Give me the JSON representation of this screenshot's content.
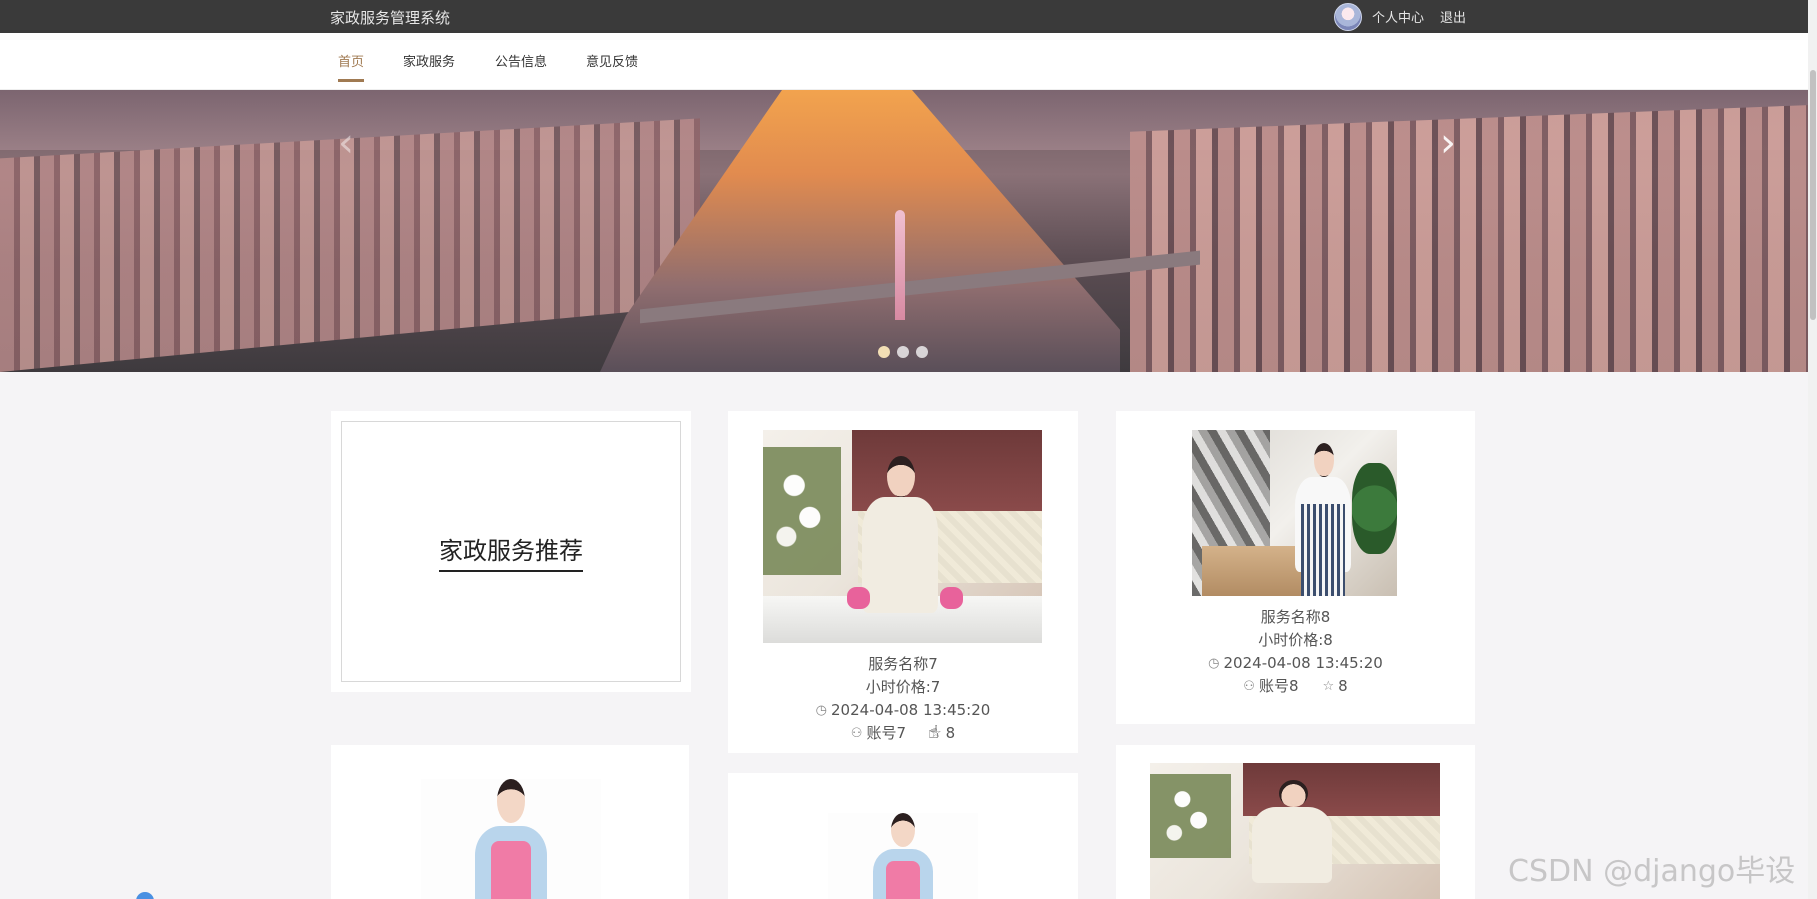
{
  "header": {
    "site_title": "家政服务管理系统",
    "profile_link": "个人中心",
    "logout_link": "退出"
  },
  "nav": {
    "items": [
      {
        "label": "首页",
        "active": true
      },
      {
        "label": "家政服务",
        "active": false
      },
      {
        "label": "公告信息",
        "active": false
      },
      {
        "label": "意见反馈",
        "active": false
      }
    ]
  },
  "banner": {
    "prev_icon": "chevron-left-icon",
    "next_icon": "chevron-right-icon",
    "slides": 3,
    "active_slide": 1
  },
  "recommend": {
    "title": "家政服务推荐"
  },
  "services": [
    {
      "name": "服务名称7",
      "price": "小时价格:7",
      "time": "2024-04-08 13:45:20",
      "account": "账号7",
      "favorites": "8"
    },
    {
      "name": "服务名称8",
      "price": "小时价格:8",
      "time": "2024-04-08 13:45:20",
      "account": "账号8",
      "favorites": "8"
    }
  ],
  "watermark": "CSDN @django毕设",
  "colors": {
    "topbar": "#3a3a3a",
    "accent": "#a07a52",
    "page_bg": "#f5f4f6"
  }
}
